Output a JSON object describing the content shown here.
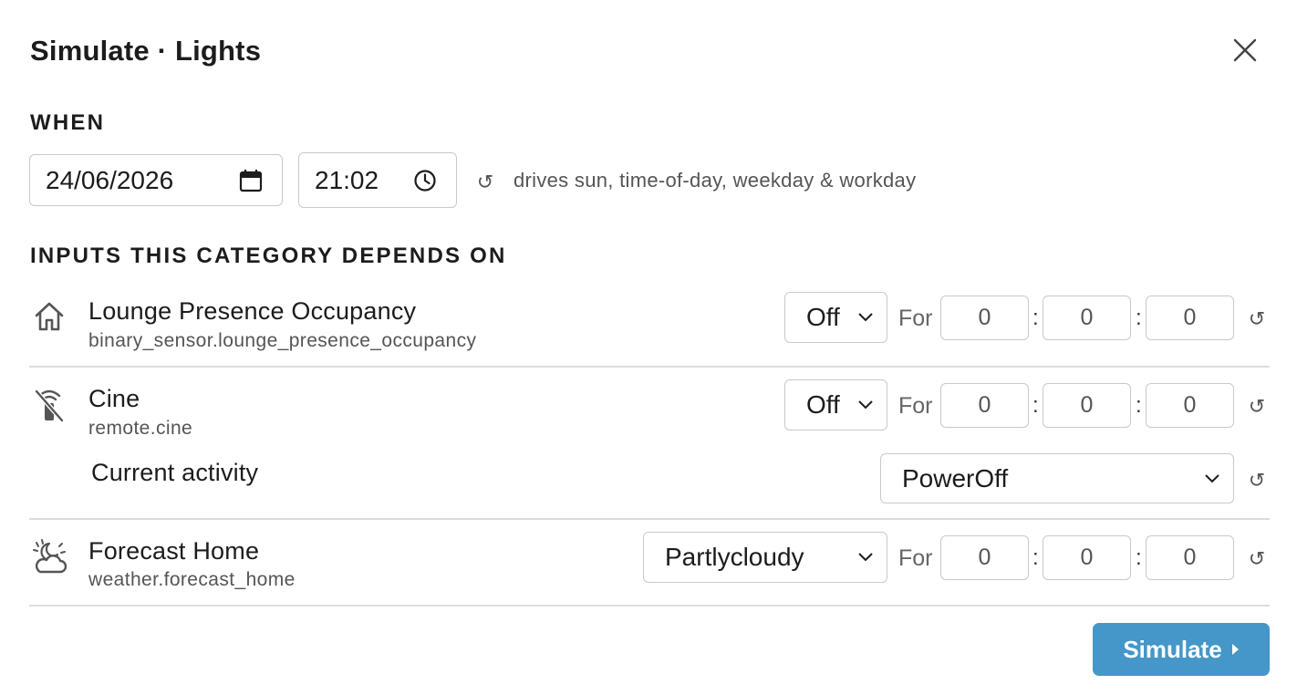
{
  "dialog": {
    "title": "Simulate · Lights",
    "close_icon": "close-icon"
  },
  "when": {
    "label": "WHEN",
    "date": "24/06/2026",
    "date_icon": "calendar-icon",
    "time": "21:02",
    "time_icon": "clock-icon",
    "reset_symbol": "↺",
    "hint": "drives sun, time-of-day, weekday & workday"
  },
  "inputs": {
    "label": "INPUTS THIS CATEGORY DEPENDS ON",
    "for_label": "For",
    "colon": ":",
    "reset_symbol": "↺",
    "items": [
      {
        "name": "Lounge Presence Occupancy",
        "entity_id": "binary_sensor.lounge_presence_occupancy",
        "icon": "home-icon",
        "state": "Off",
        "hours": "0",
        "minutes": "0",
        "seconds": "0"
      },
      {
        "name": "Cine",
        "entity_id": "remote.cine",
        "icon": "remote-off-icon",
        "state": "Off",
        "hours": "0",
        "minutes": "0",
        "seconds": "0",
        "attribute": {
          "name": "Current activity",
          "value": "PowerOff"
        }
      },
      {
        "name": "Forecast Home",
        "entity_id": "weather.forecast_home",
        "icon": "partly-cloudy-night-icon",
        "state": "Partlycloudy",
        "hours": "0",
        "minutes": "0",
        "seconds": "0"
      }
    ]
  },
  "footer": {
    "simulate_label": "Simulate"
  },
  "colors": {
    "accent": "#4497c8",
    "border": "#c9c9c9",
    "divider": "#dcdcdc",
    "muted_text": "#555555"
  }
}
